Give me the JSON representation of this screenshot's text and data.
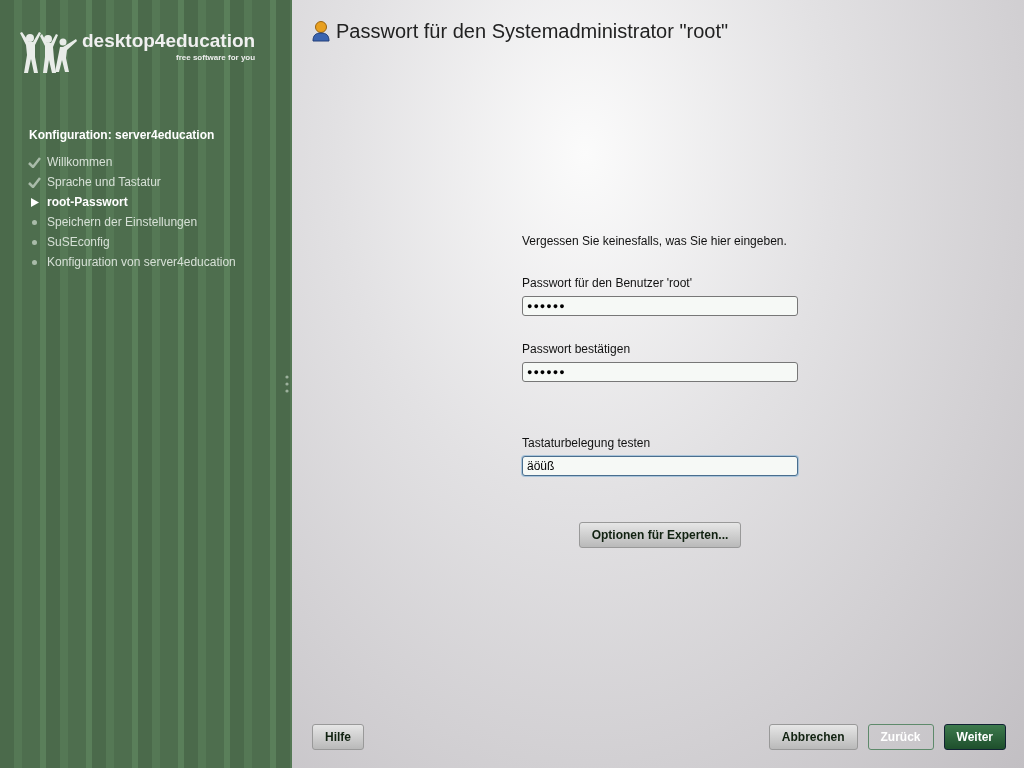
{
  "sidebar": {
    "logo": {
      "title": "desktop4education",
      "tagline": "free software for you"
    },
    "heading": "Konfiguration: server4education",
    "steps": [
      {
        "label": "Willkommen",
        "done": true,
        "current": false
      },
      {
        "label": "Sprache und Tastatur",
        "done": true,
        "current": false
      },
      {
        "label": "root-Passwort",
        "done": false,
        "current": true
      },
      {
        "label": "Speichern der Einstellungen",
        "done": false,
        "current": false
      },
      {
        "label": "SuSEconfig",
        "done": false,
        "current": false
      },
      {
        "label": "Konfiguration von server4education",
        "done": false,
        "current": false
      }
    ]
  },
  "page": {
    "title": "Passwort für den Systemadministrator \"root\"",
    "hint": "Vergessen Sie keinesfalls, was Sie hier eingeben.",
    "fields": [
      {
        "label": "Passwort für den Benutzer 'root'",
        "value": "●●●●●●",
        "focused": false
      },
      {
        "label": "Passwort bestätigen",
        "value": "●●●●●●",
        "focused": false
      },
      {
        "label": "Tastaturbelegung testen",
        "value": "äöüß",
        "focused": true
      }
    ],
    "expert_button": {
      "label": "Optionen für Experten..."
    }
  },
  "buttons": [
    {
      "label": "Hilfe",
      "kind": "plain",
      "disabled": false
    },
    {
      "label": "Abbrechen",
      "kind": "plain",
      "disabled": false
    },
    {
      "label": "Zurück",
      "kind": "plain",
      "disabled": true
    },
    {
      "label": "Weiter",
      "kind": "primary",
      "disabled": false
    }
  ]
}
